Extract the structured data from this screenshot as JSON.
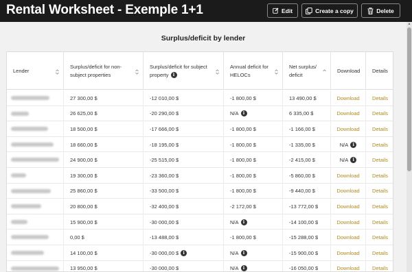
{
  "header": {
    "title": "Rental Worksheet - Exemple 1+1",
    "edit_label": "Edit",
    "copy_label": "Create a copy",
    "delete_label": "Delete"
  },
  "section_title": "Surplus/deficit by lender",
  "columns": [
    {
      "label": "Lender",
      "info": false,
      "sortable": true
    },
    {
      "label": "Surplus/deficit for non-subject properties",
      "info": false,
      "sortable": true
    },
    {
      "label": "Surplus/deficit for subject property",
      "info": true,
      "sortable": true
    },
    {
      "label": "Annual deficit for HELOCs",
      "info": false,
      "sortable": true
    },
    {
      "label": "Net surplus/ deficit",
      "info": false,
      "sortable": true,
      "sort": "asc"
    },
    {
      "label": "Download",
      "info": false,
      "sortable": false
    },
    {
      "label": "Details",
      "info": false,
      "sortable": false
    }
  ],
  "rows": [
    {
      "non_subject": "27 300,00 $",
      "subject": "-12 010,00 $",
      "subject_info": false,
      "heloc": "-1 800,00 $",
      "heloc_info": false,
      "net": "13 490,00 $",
      "download": "Download",
      "download_info": false,
      "details": "Details"
    },
    {
      "non_subject": "26 625,00 $",
      "subject": "-20 290,00 $",
      "subject_info": false,
      "heloc": "N/A",
      "heloc_info": true,
      "net": "6 335,00 $",
      "download": "Download",
      "download_info": false,
      "details": "Details"
    },
    {
      "non_subject": "18 500,00 $",
      "subject": "-17 666,00 $",
      "subject_info": false,
      "heloc": "-1 800,00 $",
      "heloc_info": false,
      "net": "-1 166,00 $",
      "download": "Download",
      "download_info": false,
      "details": "Details"
    },
    {
      "non_subject": "18 660,00 $",
      "subject": "-18 195,00 $",
      "subject_info": false,
      "heloc": "-1 800,00 $",
      "heloc_info": false,
      "net": "-1 335,00 $",
      "download": "N/A",
      "download_info": true,
      "details": "Details"
    },
    {
      "non_subject": "24 900,00 $",
      "subject": "-25 515,00 $",
      "subject_info": false,
      "heloc": "-1 800,00 $",
      "heloc_info": false,
      "net": "-2 415,00 $",
      "download": "N/A",
      "download_info": true,
      "details": "Details"
    },
    {
      "non_subject": "19 300,00 $",
      "subject": "-23 360,00 $",
      "subject_info": false,
      "heloc": "-1 800,00 $",
      "heloc_info": false,
      "net": "-5 860,00 $",
      "download": "Download",
      "download_info": false,
      "details": "Details"
    },
    {
      "non_subject": "25 860,00 $",
      "subject": "-33 500,00 $",
      "subject_info": false,
      "heloc": "-1 800,00 $",
      "heloc_info": false,
      "net": "-9 440,00 $",
      "download": "Download",
      "download_info": false,
      "details": "Details"
    },
    {
      "non_subject": "20 800,00 $",
      "subject": "-32 400,00 $",
      "subject_info": false,
      "heloc": "-2 172,00 $",
      "heloc_info": false,
      "net": "-13 772,00 $",
      "download": "Download",
      "download_info": false,
      "details": "Details"
    },
    {
      "non_subject": "15 900,00 $",
      "subject": "-30 000,00 $",
      "subject_info": false,
      "heloc": "N/A",
      "heloc_info": true,
      "net": "-14 100,00 $",
      "download": "Download",
      "download_info": false,
      "details": "Details"
    },
    {
      "non_subject": "0,00 $",
      "subject": "-13 488,00 $",
      "subject_info": false,
      "heloc": "-1 800,00 $",
      "heloc_info": false,
      "net": "-15 288,00 $",
      "download": "Download",
      "download_info": false,
      "details": "Details"
    },
    {
      "non_subject": "14 100,00 $",
      "subject": "-30 000,00 $",
      "subject_info": true,
      "heloc": "N/A",
      "heloc_info": true,
      "net": "-15 900,00 $",
      "download": "Download",
      "download_info": false,
      "details": "Details"
    },
    {
      "non_subject": "13 950,00 $",
      "subject": "-30 000,00 $",
      "subject_info": false,
      "heloc": "N/A",
      "heloc_info": true,
      "net": "-16 050,00 $",
      "download": "Download",
      "download_info": false,
      "details": "Details"
    }
  ],
  "colors": {
    "header_bg": "#1b1b1b",
    "link": "#b0891c",
    "page_bg": "#f1f1f1"
  },
  "icons": {
    "edit": "pencil-square-icon",
    "copy": "copy-icon",
    "delete": "trash-icon",
    "info": "info-icon",
    "sort": "sort-icon"
  }
}
